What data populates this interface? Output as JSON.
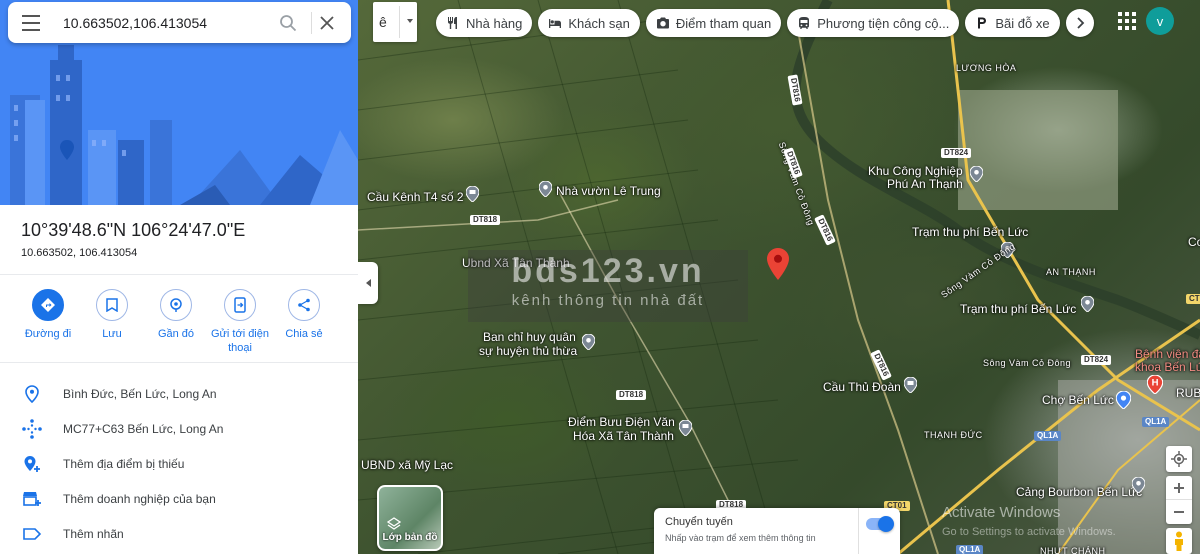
{
  "search": {
    "query": "10.663502,106.413054"
  },
  "place": {
    "dms": "10°39'48.6\"N 106°24'47.0\"E",
    "decimal": "10.663502, 106.413054"
  },
  "actions": [
    {
      "label": "Đường đi",
      "icon": "directions-icon"
    },
    {
      "label": "Lưu",
      "icon": "bookmark-icon"
    },
    {
      "label": "Gần đó",
      "icon": "nearby-icon"
    },
    {
      "label": "Gửi tới điện thoại",
      "icon": "send-to-phone-icon"
    },
    {
      "label": "Chia sẻ",
      "icon": "share-icon"
    }
  ],
  "info": [
    {
      "text": "Bình Đức, Bến Lức, Long An",
      "icon": "location-pin-icon"
    },
    {
      "text": "MC77+C63 Bến Lức, Long An",
      "icon": "plus-code-icon"
    },
    {
      "text": "Thêm địa điểm bị thiếu",
      "icon": "add-place-icon"
    },
    {
      "text": "Thêm doanh nghiệp của bạn",
      "icon": "add-business-icon"
    },
    {
      "text": "Thêm nhãn",
      "icon": "label-icon"
    }
  ],
  "lang": "ê",
  "chips": [
    "Nhà hàng",
    "Khách sạn",
    "Điểm tham quan",
    "Phương tiện công cộ...",
    "Bãi đỗ xe"
  ],
  "avatar": "v",
  "map_labels": {
    "luong_hoa": "LƯƠNG HÒA",
    "kcn": "Khu Công Nghiệp",
    "kcn2": "Phú An Thạnh",
    "cau_kenh": "Cầu Kênh T4 số 2",
    "nha_vuon": "Nhà vườn Lê Trung",
    "tram1": "Trạm thu phí Bến Lức",
    "tram2": "Trạm thu phí Bến Lức",
    "ubnd_tan_thanh": "Ubnd Xã Tân Thành",
    "an_thanh": "AN THẠNH",
    "ban_chi_huy1": "Ban chỉ huy quân",
    "ban_chi_huy2": "sự huyện thủ thừa",
    "song_vam1": "Sông Vàm Cỏ Đông",
    "song_vam2": "Sông Vàm Cỏ Đông",
    "song_vam3": "Sông Vàm Cỏ Đông",
    "benh_vien1": "Bệnh viện đa",
    "benh_vien2": "khoa Bến Lức",
    "cau_thu_doan": "Cầu Thủ Đoàn",
    "cho_ben_luc": "Chợ Bến Lức",
    "rub": "RUB",
    "diem_buu_dien1": "Điểm Bưu Điện Văn",
    "diem_buu_dien2": "Hóa Xã Tân Thành",
    "thanh_duc": "THẠNH ĐỨC",
    "ubnd_my_lac": "UBND xã Mỹ Lạc",
    "cang_bourbon": "Cảng Bourbon Bến Lức",
    "nhut_chanh": "NHỰT CHÁNH",
    "cot": "Co",
    "roads": {
      "dt818a": "DT818",
      "dt818b": "DT818",
      "dt818c": "DT818",
      "dt824a": "DT824",
      "dt824b": "DT824",
      "dt816a": "DT816",
      "dt816b": "DT816",
      "dt816c": "DT816",
      "dt816d": "DT816",
      "ct01a": "CT01",
      "ct01b": "CT01",
      "ql1a1": "QL1A",
      "ql1a2": "QL1A",
      "ql1a3": "QL1A"
    }
  },
  "watermark": {
    "big": "bds123.vn",
    "sub": "kênh thông tin nhà đất"
  },
  "layers_label": "Lớp bản đồ",
  "transit": {
    "title": "Chuyển tuyến",
    "subtitle": "Nhấp vào trạm để xem thêm thông tin"
  },
  "activate": {
    "title": "Activate Windows",
    "subtitle": "Go to Settings to activate Windows."
  }
}
